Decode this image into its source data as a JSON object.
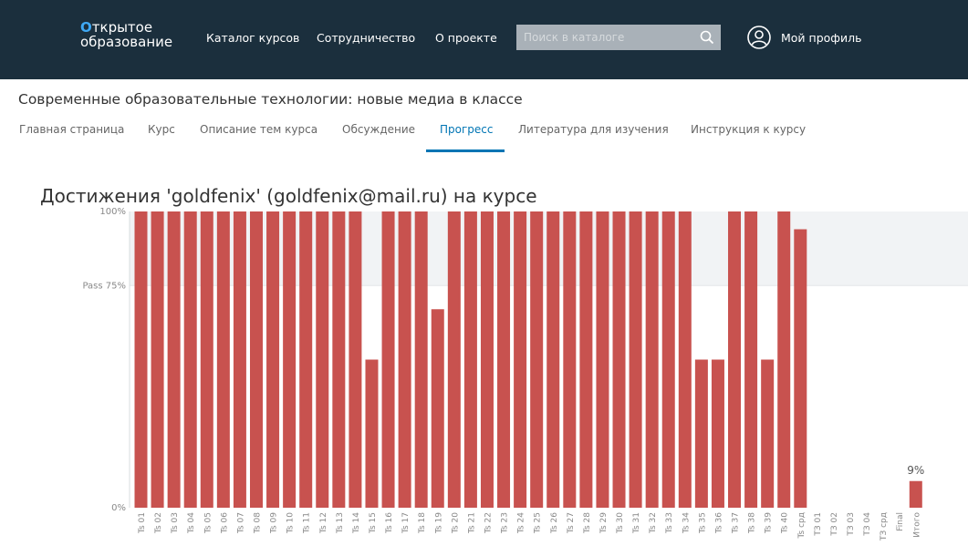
{
  "header": {
    "logo_line1_first": "О",
    "logo_line1_rest": "ткрытое",
    "logo_line2": "образование",
    "nav": [
      "Каталог курсов",
      "Сотрудничество",
      "О проекте"
    ],
    "search_placeholder": "Поиск в каталоге",
    "profile_label": "Мой профиль"
  },
  "course": {
    "title": "Современные образовательные технологии: новые медиа в классе",
    "tabs": [
      "Главная страница",
      "Курс",
      "Описание тем курса",
      "Обсуждение",
      "Прогресс",
      "Литература для изучения",
      "Инструкция к курсу"
    ],
    "active_tab": "Прогресс"
  },
  "progress_title": "Достижения 'goldfenix' (goldfenix@mail.ru) на курсе",
  "colors": {
    "bar": "#c8524f",
    "pass_band": "#f1f3f5",
    "active_tab": "#0075b4",
    "header_bg": "#1b2f3d"
  },
  "chart_data": {
    "type": "bar",
    "categories": [
      "Ts 01",
      "Ts 02",
      "Ts 03",
      "Ts 04",
      "Ts 05",
      "Ts 06",
      "Ts 07",
      "Ts 08",
      "Ts 09",
      "Ts 10",
      "Ts 11",
      "Ts 12",
      "Ts 13",
      "Ts 14",
      "Ts 15",
      "Ts 16",
      "Ts 17",
      "Ts 18",
      "Ts 19",
      "Ts 20",
      "Ts 21",
      "Ts 22",
      "Ts 23",
      "Ts 24",
      "Ts 25",
      "Ts 26",
      "Ts 27",
      "Ts 28",
      "Ts 29",
      "Ts 30",
      "Ts 31",
      "Ts 32",
      "Ts 33",
      "Ts 34",
      "Ts 35",
      "Ts 36",
      "Ts 37",
      "Ts 38",
      "Ts 39",
      "Ts 40",
      "Ts срд",
      "ТЗ 01",
      "ТЗ 02",
      "ТЗ 03",
      "ТЗ 04",
      "ТЗ срд",
      "Final",
      "Итого"
    ],
    "values": [
      100,
      100,
      100,
      100,
      100,
      100,
      100,
      100,
      100,
      100,
      100,
      100,
      100,
      100,
      50,
      100,
      100,
      100,
      67,
      100,
      100,
      100,
      100,
      100,
      100,
      100,
      100,
      100,
      100,
      100,
      100,
      100,
      100,
      100,
      50,
      50,
      100,
      100,
      50,
      100,
      94,
      0,
      0,
      0,
      0,
      0,
      0,
      9
    ],
    "y_ticks": [
      {
        "value": 100,
        "label": "100%"
      },
      {
        "value": 75,
        "label": "Pass 75%"
      },
      {
        "value": 0,
        "label": "0%"
      }
    ],
    "pass_value": 75,
    "ylim": [
      0,
      100
    ],
    "annotations": [
      {
        "category": "Итого",
        "label": "9%"
      }
    ]
  }
}
